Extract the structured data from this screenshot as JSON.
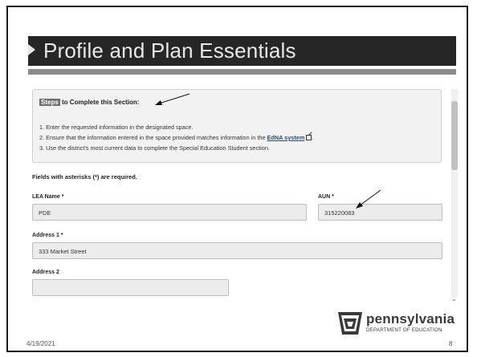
{
  "slide": {
    "title": "Profile and Plan Essentials",
    "date": "4/19/2021",
    "page_number": "8"
  },
  "steps": {
    "heading_highlight": "Steps",
    "heading_rest": " to Complete this Section:",
    "items": [
      "1. Enter the requested information in the designated space.",
      "2. Ensure that the information entered in the space provided matches information in the ",
      "3. Use the district's most current data to complete the Special Education Student section."
    ],
    "link_text": "EdNA system",
    "after_link": "."
  },
  "form": {
    "required_note": "Fields with asterisks (*) are required.",
    "lea_name_label": "LEA Name *",
    "lea_name_value": "PDE",
    "aun_label": "AUN *",
    "aun_value": "315220083",
    "address1_label": "Address 1 *",
    "address1_value": "333 Market Street",
    "address2_label": "Address 2",
    "address2_value": ""
  },
  "logo": {
    "word": "pennsylvania",
    "subtitle": "DEPARTMENT OF EDUCATION"
  },
  "icons": {
    "external_link": "external-link-icon",
    "scroll_down": "chevron-down-icon",
    "keystone": "keystone-logo-icon"
  }
}
